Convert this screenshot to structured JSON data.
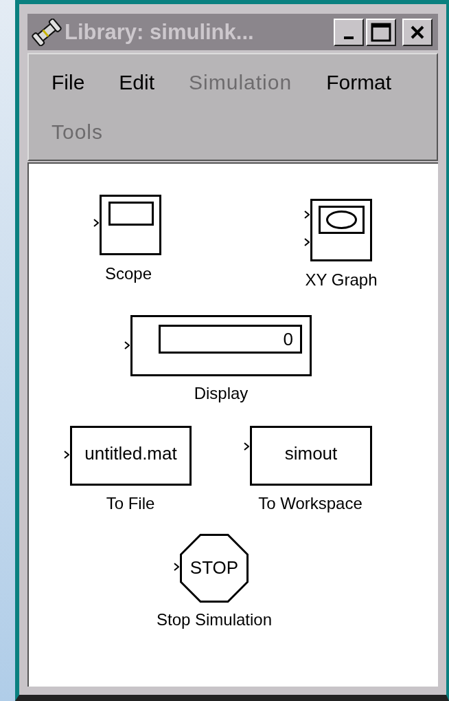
{
  "window": {
    "title": "Library: simulink..."
  },
  "menu": [
    {
      "label": "File",
      "disabled": false
    },
    {
      "label": "Edit",
      "disabled": false
    },
    {
      "label": "Simulation",
      "disabled": true
    },
    {
      "label": "Format",
      "disabled": false
    },
    {
      "label": "Tools",
      "disabled": true
    }
  ],
  "blocks": [
    {
      "kind": "scope",
      "label": "Scope"
    },
    {
      "kind": "xy_graph",
      "label": "XY Graph"
    },
    {
      "kind": "display",
      "label": "Display",
      "text": "0"
    },
    {
      "kind": "to_file",
      "label": "To File",
      "text": "untitled.mat"
    },
    {
      "kind": "to_workspace",
      "label": "To Workspace",
      "text": "simout"
    },
    {
      "kind": "stop",
      "label": "Stop Simulation",
      "text": "STOP"
    }
  ]
}
